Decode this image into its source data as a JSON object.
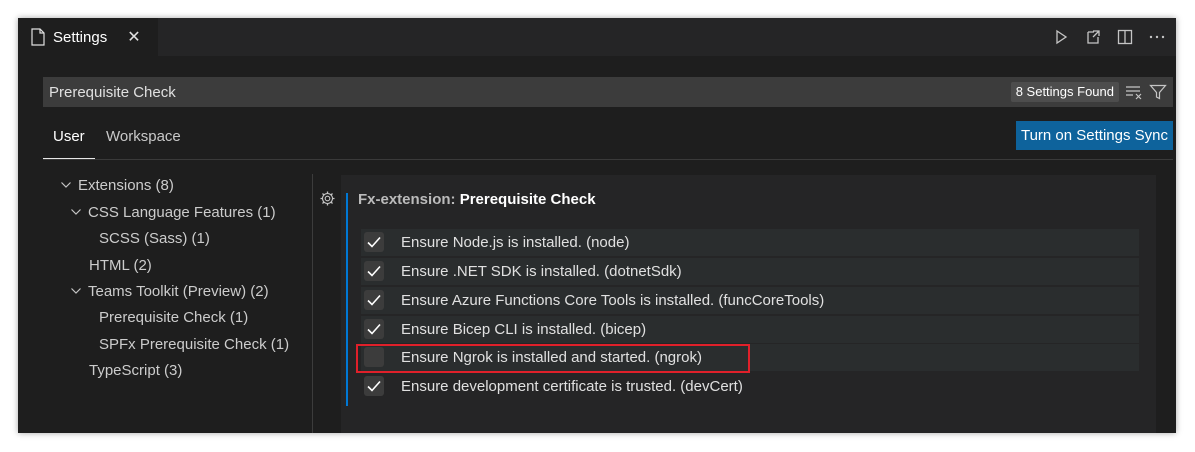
{
  "tab": {
    "title": "Settings",
    "close": "✕"
  },
  "search": {
    "query": "Prerequisite Check",
    "found": "8 Settings Found"
  },
  "scope": {
    "user": "User",
    "workspace": "Workspace",
    "sync_button": "Turn on Settings Sync"
  },
  "tree": [
    {
      "label": "Extensions (8)",
      "expanded": true
    },
    {
      "label": "CSS Language Features (1)",
      "expanded": true
    },
    {
      "label": "SCSS (Sass) (1)"
    },
    {
      "label": "HTML (2)"
    },
    {
      "label": "Teams Toolkit (Preview) (2)",
      "expanded": true
    },
    {
      "label": "Prerequisite Check (1)"
    },
    {
      "label": "SPFx Prerequisite Check (1)"
    },
    {
      "label": "TypeScript (3)"
    }
  ],
  "group": {
    "prefix": "Fx-extension: ",
    "name": "Prerequisite Check"
  },
  "settings": [
    {
      "label": "Ensure Node.js is installed. (node)",
      "checked": true
    },
    {
      "label": "Ensure .NET SDK is installed. (dotnetSdk)",
      "checked": true
    },
    {
      "label": "Ensure Azure Functions Core Tools is installed. (funcCoreTools)",
      "checked": true
    },
    {
      "label": "Ensure Bicep CLI is installed. (bicep)",
      "checked": true
    },
    {
      "label": "Ensure Ngrok is installed and started. (ngrok)",
      "checked": false
    },
    {
      "label": "Ensure development certificate is trusted. (devCert)",
      "checked": true
    }
  ],
  "colors": {
    "accent": "#0e639c",
    "highlight": "#e0202a",
    "background": "#1e1e1e"
  }
}
